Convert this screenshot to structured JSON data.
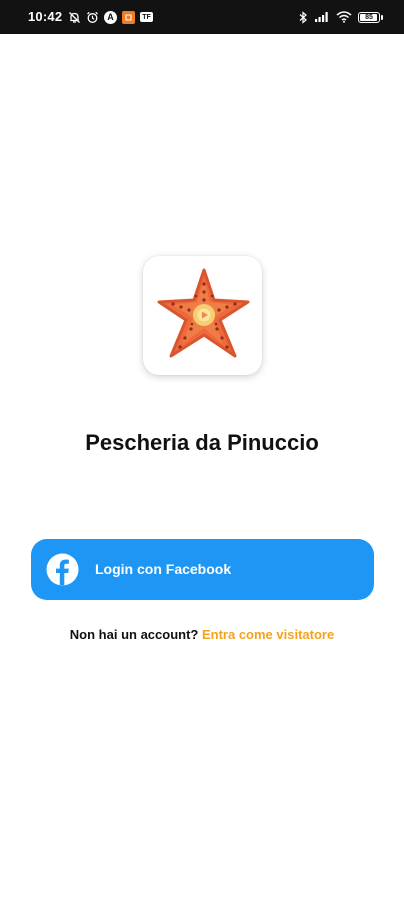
{
  "status_bar": {
    "time": "10:42",
    "battery_level": "85",
    "left_icons": [
      "notifications-off-icon",
      "alarm-icon",
      "a-app-icon",
      "orange-app-icon",
      "box-app-icon"
    ],
    "right_icons": [
      "bluetooth-icon",
      "cell-signal-icon",
      "wifi-icon",
      "battery-icon"
    ],
    "colors": {
      "background": "#121212",
      "foreground": "#ffffff",
      "orange_app": "#f07b22"
    }
  },
  "logo": {
    "icon": "starfish-icon",
    "colors": {
      "star": "#ee6a3c",
      "star_dark": "#c94f2a",
      "center": "#f6cf73",
      "dots": "#8c2d1c"
    }
  },
  "app": {
    "title": "Pescheria da Pinuccio"
  },
  "facebook_login": {
    "label": "Login con Facebook",
    "icon": "facebook-icon",
    "color": "#1e96f5"
  },
  "guest": {
    "prompt": "Non hai un account?",
    "link_label": "Entra come visitatore",
    "link_color": "#f5a21b"
  }
}
